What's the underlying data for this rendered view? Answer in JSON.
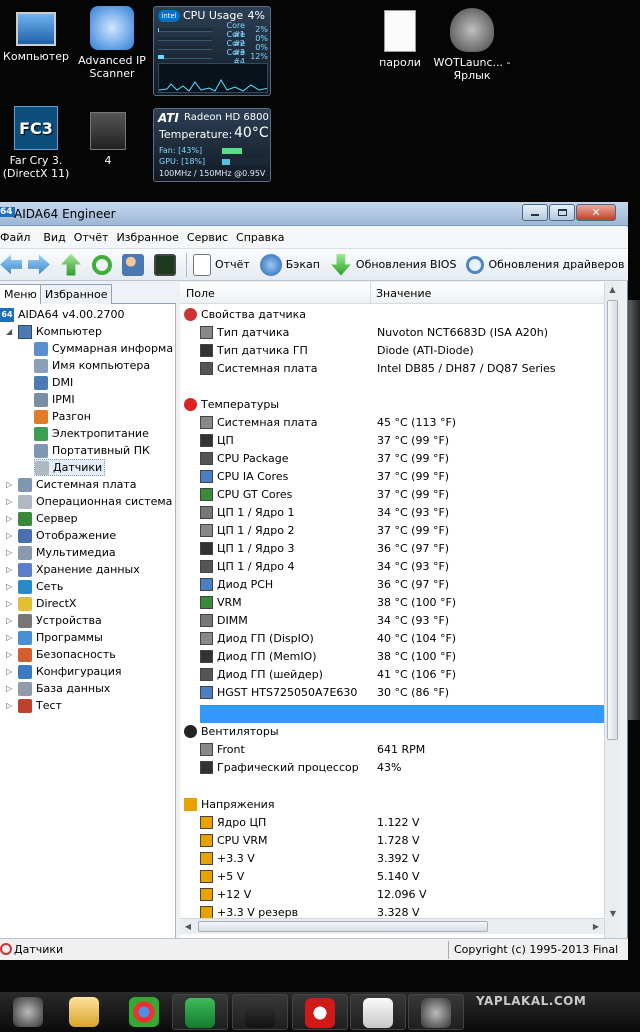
{
  "desktop": {
    "icons": [
      {
        "label": "Компьютер"
      },
      {
        "label": "Advanced IP Scanner"
      },
      {
        "label": "пароли"
      },
      {
        "label": "WOTLaunc... - Ярлык"
      },
      {
        "label": "Far Cry 3.(DirectX 11)",
        "badge": "FC3"
      },
      {
        "label": "4"
      }
    ],
    "cpu_gadget": {
      "title": "CPU Usage",
      "total": "4%",
      "cores": [
        {
          "label": "Core #1",
          "value": "2%"
        },
        {
          "label": "Core #2",
          "value": "0%"
        },
        {
          "label": "Core #3",
          "value": "0%"
        },
        {
          "label": "Core #4",
          "value": "12%"
        }
      ]
    },
    "gpu_gadget": {
      "brand": "ATI",
      "model": "Radeon HD 6800",
      "temp_label": "Temperature:",
      "temp_value": "40°C",
      "fan": "Fan: [43%]",
      "gpu": "GPU: [18%]",
      "clocks": "100MHz / 150MHz @0.95V",
      "fan_level": 0.43,
      "gpu_level": 0.18
    }
  },
  "window": {
    "title": "AIDA64 Engineer",
    "app_badge": "64",
    "menu": [
      "Файл",
      "Вид",
      "Отчёт",
      "Избранное",
      "Сервис",
      "Справка"
    ],
    "toolbar": {
      "report": "Отчёт",
      "backup": "Бэкап",
      "bios": "Обновления BIOS",
      "drivers": "Обновления драйверов"
    },
    "tabs": {
      "menu": "Меню",
      "favorites": "Избранное"
    },
    "tree": {
      "root": "AIDA64 v4.00.2700",
      "computer": "Компьютер",
      "computer_children": [
        "Суммарная информа",
        "Имя компьютера",
        "DMI",
        "IPMI",
        "Разгон",
        "Электропитание",
        "Портативный ПК",
        "Датчики"
      ],
      "top_items": [
        "Системная плата",
        "Операционная система",
        "Сервер",
        "Отображение",
        "Мультимедиа",
        "Хранение данных",
        "Сеть",
        "DirectX",
        "Устройства",
        "Программы",
        "Безопасность",
        "Конфигурация",
        "База данных",
        "Тест"
      ]
    },
    "columns": {
      "field": "Поле",
      "value": "Значение"
    },
    "groups": {
      "sensor": {
        "title": "Свойства датчика",
        "rows": [
          {
            "field": "Тип датчика",
            "value": "Nuvoton NCT6683D  (ISA A20h)"
          },
          {
            "field": "Тип датчика ГП",
            "value": "Diode  (ATI-Diode)"
          },
          {
            "field": "Системная плата",
            "value": "Intel DB85 / DH87 / DQ87 Series"
          }
        ]
      },
      "temps": {
        "title": "Температуры",
        "rows": [
          {
            "field": "Системная плата",
            "value": "45 °C  (113 °F)"
          },
          {
            "field": "ЦП",
            "value": "37 °C  (99 °F)"
          },
          {
            "field": "CPU Package",
            "value": "37 °C  (99 °F)"
          },
          {
            "field": "CPU IA Cores",
            "value": "37 °C  (99 °F)"
          },
          {
            "field": "CPU GT Cores",
            "value": "37 °C  (99 °F)"
          },
          {
            "field": "ЦП 1 / Ядро 1",
            "value": "34 °C  (93 °F)"
          },
          {
            "field": "ЦП 1 / Ядро 2",
            "value": "37 °C  (99 °F)"
          },
          {
            "field": "ЦП 1 / Ядро 3",
            "value": "36 °C  (97 °F)"
          },
          {
            "field": "ЦП 1 / Ядро 4",
            "value": "34 °C  (93 °F)"
          },
          {
            "field": "Диод PCH",
            "value": "36 °C  (97 °F)"
          },
          {
            "field": "VRM",
            "value": "38 °C  (100 °F)"
          },
          {
            "field": "DIMM",
            "value": "34 °C  (93 °F)"
          },
          {
            "field": "Диод ГП (DispIO)",
            "value": "40 °C  (104 °F)"
          },
          {
            "field": "Диод ГП (MemIO)",
            "value": "38 °C  (100 °F)"
          },
          {
            "field": "Диод ГП (шейдер)",
            "value": "41 °C  (106 °F)"
          },
          {
            "field": "HGST HTS725050A7E630",
            "value": "30 °C  (86 °F)"
          }
        ]
      },
      "fans": {
        "title": "Вентиляторы",
        "rows": [
          {
            "field": "Front",
            "value": "641 RPM"
          },
          {
            "field": "Графический процессор",
            "value": "43%"
          }
        ]
      },
      "volts": {
        "title": "Напряжения",
        "rows": [
          {
            "field": "Ядро ЦП",
            "value": "1.122 V"
          },
          {
            "field": "CPU VRM",
            "value": "1.728 V"
          },
          {
            "field": "+3.3 V",
            "value": "3.392 V"
          },
          {
            "field": "+5 V",
            "value": "5.140 V"
          },
          {
            "field": "+12 V",
            "value": "12.096 V"
          },
          {
            "field": "+3.3 V резерв",
            "value": "3.328 V"
          }
        ]
      }
    },
    "status": {
      "left": "Датчики",
      "right": "Copyright (c) 1995-2013 Final"
    }
  },
  "taskbar": {
    "watermark": "YAPLAKAL.COM",
    "apps": [
      "wot-icon",
      "explorer-icon",
      "chrome-icon",
      "mail-icon",
      "a-icon",
      "opera-icon",
      "notepad-icon",
      "wot-icon"
    ]
  }
}
